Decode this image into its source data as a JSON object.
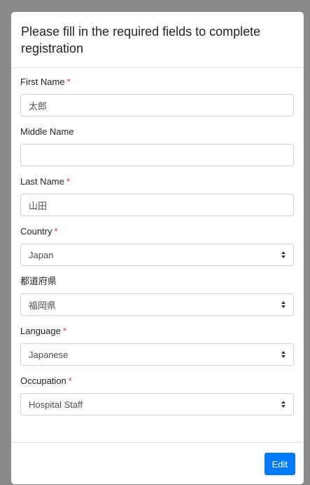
{
  "modal": {
    "title": "Please fill in the required fields to complete registration"
  },
  "required_mark": "*",
  "fields": {
    "first_name": {
      "label": "First Name",
      "value": "太郎",
      "required": true
    },
    "middle_name": {
      "label": "Middle Name",
      "value": "",
      "required": false
    },
    "last_name": {
      "label": "Last Name",
      "value": "山田",
      "required": true
    },
    "country": {
      "label": "Country",
      "value": "Japan",
      "required": true
    },
    "prefecture": {
      "label": "都道府県",
      "value": "福岡県",
      "required": false
    },
    "language": {
      "label": "Language",
      "value": "Japanese",
      "required": true
    },
    "occupation": {
      "label": "Occupation",
      "value": "Hospital Staff",
      "required": true
    }
  },
  "footer": {
    "edit_label": "Edit"
  },
  "colors": {
    "backdrop": "#8a8a8a",
    "primary": "#007bff",
    "required": "#dc3545",
    "border": "#ced4da"
  },
  "icons": {
    "select_caret": "select-caret-icon"
  }
}
